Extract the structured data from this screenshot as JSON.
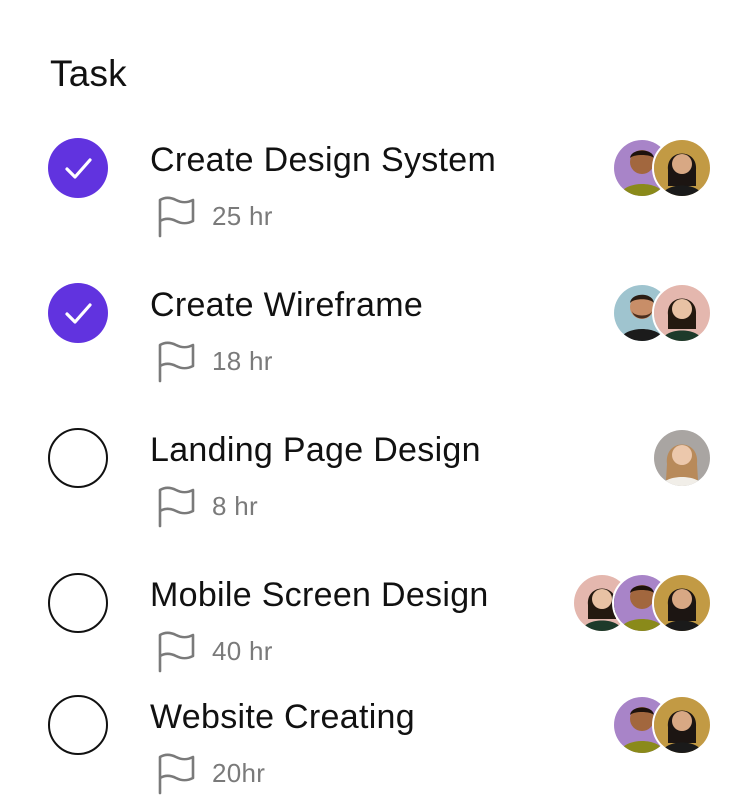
{
  "header": {
    "title": "Task"
  },
  "colors": {
    "accent": "#6133df",
    "muted_text": "#7a7a7a"
  },
  "tasks": [
    {
      "name": "Create Design System",
      "hours": "25 hr",
      "completed": true,
      "assignees": [
        "avatar-man-purple-bg",
        "avatar-woman-gold-bg"
      ]
    },
    {
      "name": "Create Wireframe",
      "hours": "18 hr",
      "completed": true,
      "assignees": [
        "avatar-man-blue-bg",
        "avatar-woman-pink-bg"
      ]
    },
    {
      "name": "Landing Page Design",
      "hours": "8 hr",
      "completed": false,
      "assignees": [
        "avatar-woman-grey-bg"
      ]
    },
    {
      "name": "Mobile Screen Design",
      "hours": "40 hr",
      "completed": false,
      "assignees": [
        "avatar-woman-pink-bg",
        "avatar-man-purple-bg",
        "avatar-woman-gold-bg"
      ]
    },
    {
      "name": "Website Creating",
      "hours": "20hr",
      "completed": false,
      "assignees": [
        "avatar-man-purple-bg",
        "avatar-woman-gold-bg"
      ]
    }
  ],
  "icons": {
    "check": "check-icon",
    "flag": "flag-icon"
  }
}
